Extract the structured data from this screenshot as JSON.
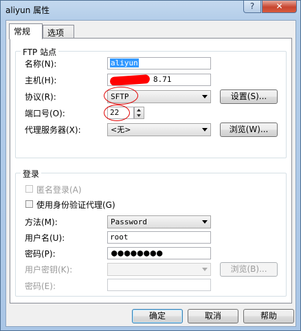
{
  "window": {
    "title": "aliyun 属性",
    "help_button": "?",
    "close_button": "✕"
  },
  "tabs": [
    {
      "label": "常规",
      "active": true
    },
    {
      "label": "选项",
      "active": false
    }
  ],
  "ftp_site": {
    "legend": "FTP 站点",
    "name_label": "名称(N):",
    "name_value": "aliyun",
    "host_label": "主机(H):",
    "host_value": "8.71",
    "protocol_label": "协议(R):",
    "protocol_value": "SFTP",
    "settings_button": "设置(S)...",
    "port_label": "端口号(O):",
    "port_value": "22",
    "proxy_label": "代理服务器(X):",
    "proxy_value": "<无>",
    "browse_button": "浏览(W)..."
  },
  "login": {
    "legend": "登录",
    "anonymous_label": "匿名登录(A)",
    "auth_proxy_label": "使用身份验证代理(G)",
    "method_label": "方法(M):",
    "method_value": "Password",
    "username_label": "用户名(U):",
    "username_value": "root",
    "password_label": "密码(P):",
    "password_value": "●●●●●●●●",
    "user_key_label": "用户密钥(K):",
    "user_key_value": "",
    "key_browse_button": "浏览(B)...",
    "passphrase_label": "密码(E):",
    "passphrase_value": ""
  },
  "footer": {
    "ok_button": "确定",
    "cancel_button": "取消",
    "help_button": "帮助"
  },
  "colors": {
    "annotation_red": "#ff0000",
    "selection_blue": "#3399ff"
  }
}
